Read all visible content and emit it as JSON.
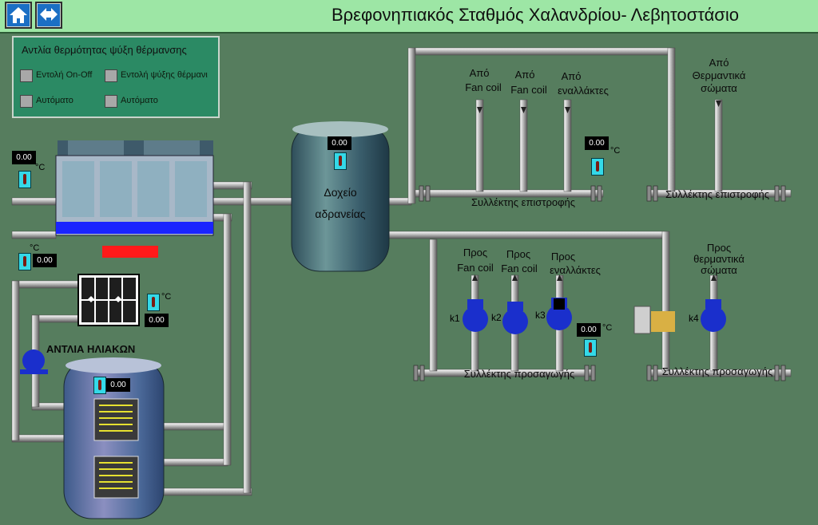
{
  "header": {
    "title": "Βρεφονηπιακός Σταθμός Χαλανδρίου- Λεβητοστάσιο",
    "home_icon": "home-icon",
    "nav_icon": "navigation-arrows-icon"
  },
  "control_panel": {
    "title": "Αντλία θερμότητας ψύξη θέρμανσης",
    "items": [
      {
        "label": "Εντολή On-Off"
      },
      {
        "label": "Εντολή ψύξης θέρμανι"
      },
      {
        "label": "Αυτόματο"
      },
      {
        "label": "Αυτόματο"
      }
    ]
  },
  "readings": {
    "temp_heat_pump_in": "0.00",
    "temp_heat_pump_out": "0.00",
    "temp_solar": "0.00",
    "temp_tank": "0.00",
    "temp_inertia": "0.00",
    "temp_return": "0.00",
    "temp_supply": "0.00",
    "unit": "°C"
  },
  "labels": {
    "solar_pump": "ΑΝΤΛΙΑ ΗΛΙΑΚΩΝ",
    "inertia_tank": [
      "Δοχείο",
      "αδρανείας"
    ],
    "return_collector_1": "Συλλέκτης επιστροφής",
    "return_collector_2": "Συλλέκτης επιστροφής",
    "supply_collector_1": "Συλλέκτης προσαγωγής",
    "supply_collector_2": "Συλλέκτης προσαγωγής",
    "from_fc1": [
      "Από",
      "Fan coil"
    ],
    "from_fc2": [
      "Από",
      "Fan coil"
    ],
    "from_hx": [
      "Από",
      "εναλλάκτες"
    ],
    "from_rad": [
      "Από",
      "Θερμαντικά",
      "σώματα"
    ],
    "to_fc1": [
      "Προς",
      "Fan coil"
    ],
    "to_fc2": [
      "Προς",
      "Fan coil"
    ],
    "to_hx": [
      "Προς",
      "εναλλάκτες"
    ],
    "to_rad": [
      "Προς",
      "θερμαντικά",
      "σώματα"
    ],
    "pumps": [
      "k1",
      "k2",
      "k3",
      "k4"
    ]
  }
}
